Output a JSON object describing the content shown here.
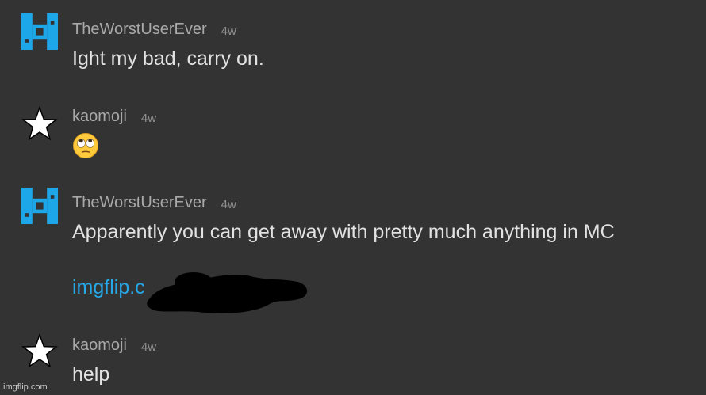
{
  "comments": [
    {
      "username": "TheWorstUserEver",
      "time": "4w",
      "avatar": "pixel-logo-icon",
      "text": "Ight my bad, carry on."
    },
    {
      "username": "kaomoji",
      "time": "4w",
      "avatar": "star-icon",
      "emoji": "face-with-rolling-eyes-icon"
    },
    {
      "username": "TheWorstUserEver",
      "time": "4w",
      "avatar": "pixel-logo-icon",
      "text": "Apparently you can get away with pretty much anything in MC",
      "link": "imgflip.c"
    },
    {
      "username": "kaomoji",
      "time": "4w",
      "avatar": "star-icon",
      "text": "help"
    }
  ],
  "watermark": "imgflip.com",
  "colors": {
    "background": "#333333",
    "username": "#a9a9a9",
    "text": "#e2e2e2",
    "link": "#26a7e6",
    "logo": "#1ea7e8"
  }
}
